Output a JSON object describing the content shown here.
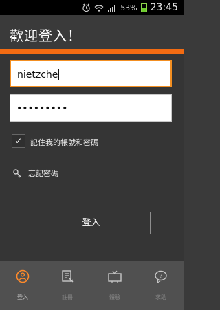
{
  "status": {
    "battery": "53%",
    "time": "23:45"
  },
  "header": {
    "title": "歡迎登入！"
  },
  "form": {
    "username": "nietzche",
    "password_mask": "•••••••••",
    "remember_label": "記住我的帳號和密碼",
    "forgot_label": "忘記密碼",
    "login_button": "登入"
  },
  "nav": {
    "items": [
      {
        "label": "登入",
        "icon": "login-user-icon"
      },
      {
        "label": "註冊",
        "icon": "register-document-icon"
      },
      {
        "label": "體驗",
        "icon": "experience-tv-icon"
      },
      {
        "label": "求助",
        "icon": "help-question-icon"
      }
    ]
  },
  "colors": {
    "accent": "#f36b12",
    "background": "#3a3a3a"
  }
}
